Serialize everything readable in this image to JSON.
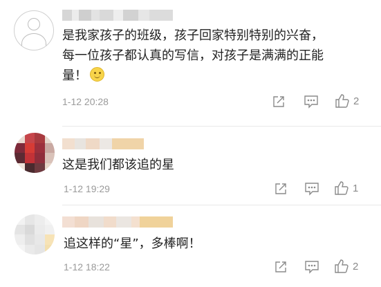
{
  "comments": [
    {
      "text_lines": [
        "是我家孩子的班级，孩子回家特别特别的兴奋，",
        "每一位孩子都认真的写信，对孩子是满满的正能",
        "量！"
      ],
      "emoji": "smile-emoji",
      "time": "1-12 20:28",
      "like_count": "2",
      "avatar": "default-avatar"
    },
    {
      "text_lines": [
        "这是我们都该追的星"
      ],
      "time": "1-12 19:29",
      "like_count": "1",
      "avatar": "pixelated-avatar"
    },
    {
      "text_lines": [
        "追这样的“星”，多棒啊！"
      ],
      "time": "1-12 18:22",
      "like_count": "2",
      "avatar": "pixelated-avatar"
    }
  ],
  "icons": {
    "share": "share-icon",
    "comment": "comment-icon",
    "like": "like-icon"
  },
  "colors": {
    "text": "#222222",
    "meta": "#9a9a9a",
    "icon": "#8a8a8a",
    "divider": "#e8e8e8"
  }
}
